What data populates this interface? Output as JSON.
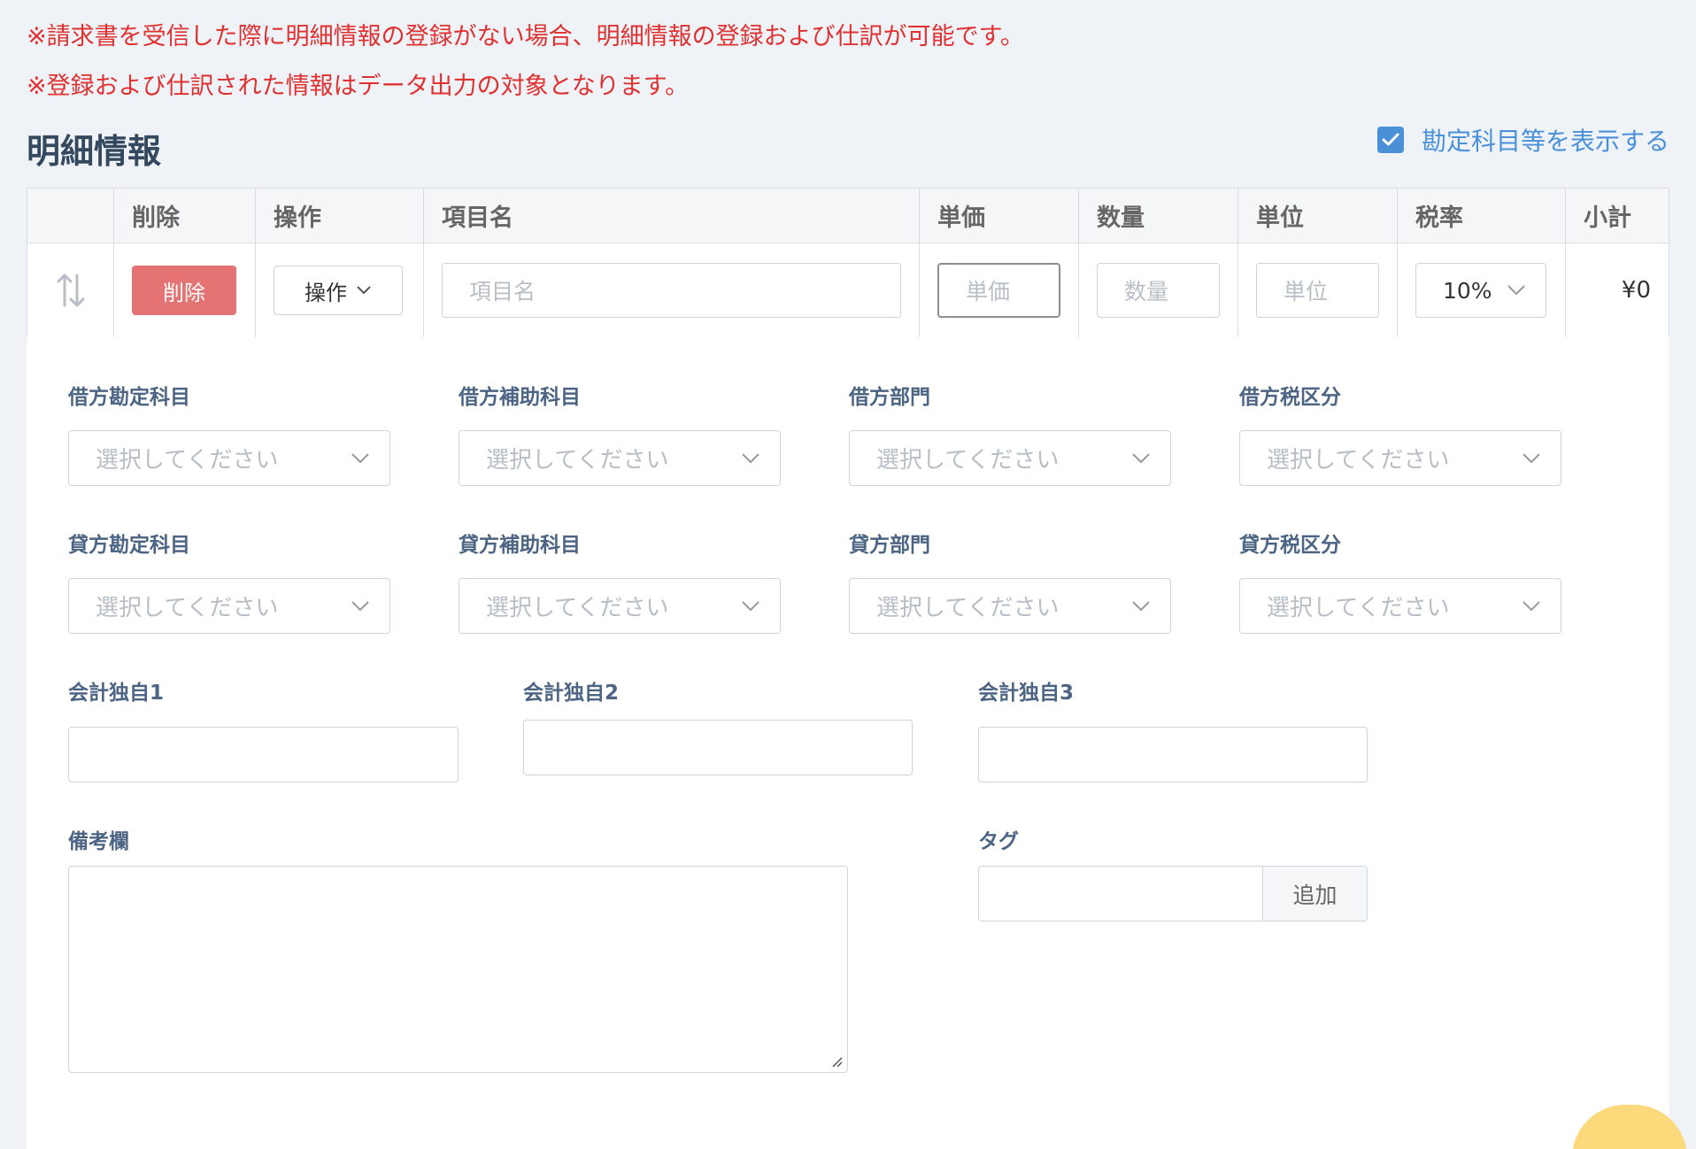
{
  "notices": [
    "※請求書を受信した際に明細情報の登録がない場合、明細情報の登録および仕訳が可能です。",
    "※登録および仕訳された情報はデータ出力の対象となります。"
  ],
  "section": {
    "title": "明細情報",
    "show_accounts_label": "勘定科目等を表示する",
    "show_accounts_checked": true
  },
  "table": {
    "headers": {
      "delete": "削除",
      "operation": "操作",
      "item_name": "項目名",
      "unit_price": "単価",
      "quantity": "数量",
      "unit": "単位",
      "tax_rate": "税率",
      "subtotal": "小計"
    },
    "row": {
      "delete_button": "削除",
      "operation_button": "操作",
      "item_name_placeholder": "項目名",
      "unit_price_placeholder": "単価",
      "quantity_placeholder": "数量",
      "unit_placeholder": "単位",
      "tax_rate_value": "10%",
      "subtotal_value": "¥0"
    }
  },
  "details": {
    "select_placeholder": "選択してください",
    "debit_account_label": "借方勘定科目",
    "debit_sub_account_label": "借方補助科目",
    "debit_department_label": "借方部門",
    "debit_tax_label": "借方税区分",
    "credit_account_label": "貸方勘定科目",
    "credit_sub_account_label": "貸方補助科目",
    "credit_department_label": "貸方部門",
    "credit_tax_label": "貸方税区分",
    "custom1_label": "会計独自1",
    "custom2_label": "会計独自2",
    "custom3_label": "会計独自3",
    "remarks_label": "備考欄",
    "tag_label": "タグ",
    "tag_add_button": "追加"
  },
  "colors": {
    "notice": "#e03131",
    "accent": "#4a90d9",
    "delete_button": "#e57373"
  }
}
